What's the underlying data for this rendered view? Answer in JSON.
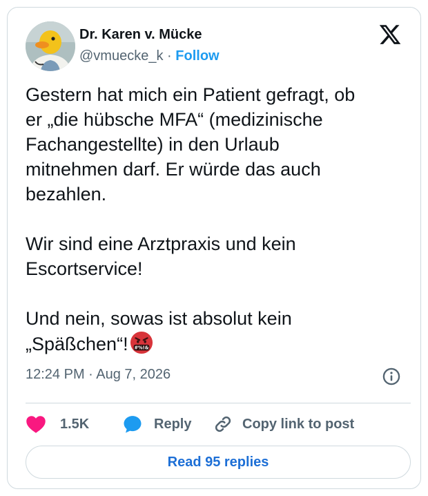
{
  "author": {
    "display_name": "Dr. Karen v. Mücke",
    "handle": "@vmuecke_k",
    "separator": "·",
    "follow_label": "Follow",
    "avatar_icon": "duck-avatar-icon"
  },
  "tweet": {
    "text": "Gestern hat mich ein Patient gefragt, ob\ner „die hübsche MFA“ (medizinische\nFachangestellte) in den Urlaub\nmitnehmen darf. Er würde das auch\nbezahlen.\n\nWir sind eine Arztpraxis und kein\nEscortservice!\n\nUnd nein, sowas ist absolut kein\n„Späßchen“!",
    "emoji_icon": "angry-cursing-face-icon",
    "timestamp": "12:24 PM · Aug 7, 2026"
  },
  "actions": {
    "like_count": "1.5K",
    "reply_label": "Reply",
    "copy_link_label": "Copy link to post"
  },
  "read_replies_label": "Read 95 replies",
  "colors": {
    "accent": "#1d9bf0",
    "like": "#f91880",
    "secondary_text": "#536471",
    "border": "#cfd9de"
  }
}
